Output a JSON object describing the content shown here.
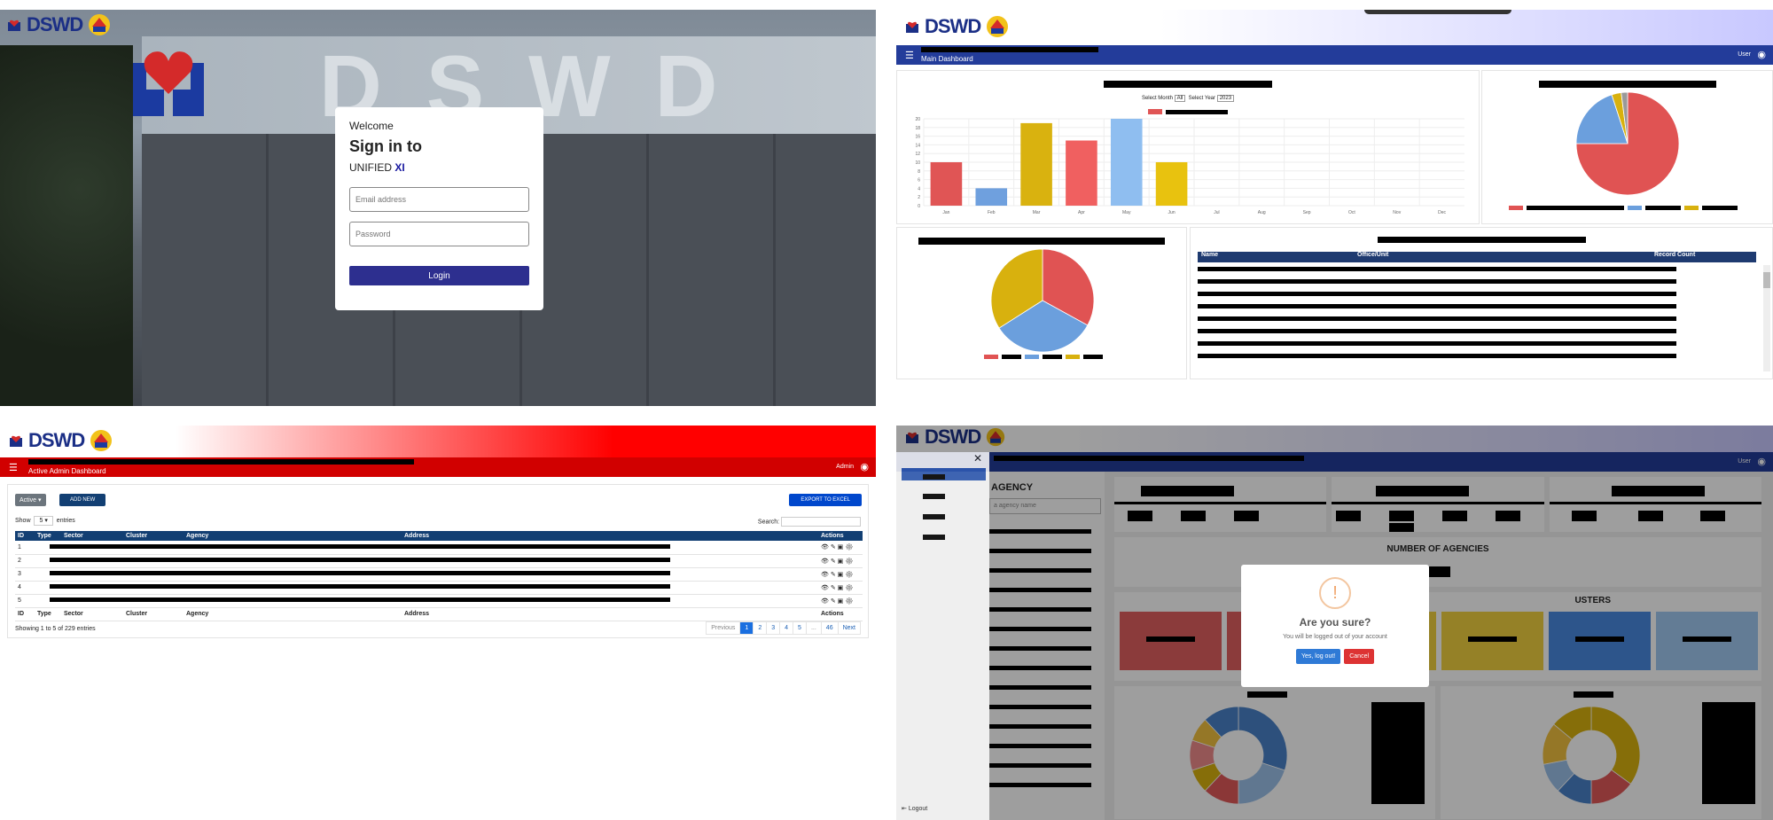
{
  "login": {
    "brand": "DSWD",
    "sign_text": "DSWD",
    "welcome": "Welcome",
    "sign_in": "Sign in to",
    "app_name_prefix": "UNIFIED ",
    "app_name_suffix": "XI",
    "email_placeholder": "Email address",
    "password_placeholder": "Password",
    "login_label": "Login"
  },
  "dashboard": {
    "brand": "DSWD",
    "subtitle": "Main Dashboard",
    "user_label": "User",
    "month_label": "Select Month",
    "month_value": "All",
    "year_label": "Select Year",
    "year_value": "2023",
    "months": [
      "Jan",
      "Feb",
      "Mar",
      "Apr",
      "May",
      "Jun",
      "Jul",
      "Aug",
      "Sep",
      "Oct",
      "Nov",
      "Dec"
    ],
    "bar_values": [
      10,
      4,
      19,
      15,
      20,
      10,
      0,
      0,
      0,
      0,
      0,
      0
    ],
    "bar_colors": [
      "#e05555",
      "#6fa0de",
      "#d9b20f",
      "#f06060",
      "#8fbef0",
      "#e8c20f",
      "#ccc",
      "#ccc",
      "#ccc",
      "#ccc",
      "#ccc",
      "#ccc"
    ],
    "yticks": [
      "0",
      "2",
      "4",
      "6",
      "8",
      "10",
      "12",
      "14",
      "16",
      "18",
      "20"
    ],
    "pie1_values": [
      75,
      20,
      3,
      2
    ],
    "pie1_colors": [
      "#e05353",
      "#6b9fdd",
      "#d8b10e",
      "#9a9a9a"
    ],
    "pie2_values": [
      33,
      33,
      34
    ],
    "pie2_colors": [
      "#e05353",
      "#6b9fdd",
      "#d8b10e"
    ],
    "table_headers": [
      "Name",
      "Office/Unit",
      "Record Count"
    ]
  },
  "admin": {
    "brand": "DSWD",
    "subtitle": "Active Admin Dashboard",
    "user_label": "Admin",
    "filter_label": "Active",
    "add_new": "ADD NEW",
    "export": "EXPORT TO EXCEL",
    "show_label": "Show",
    "show_value": "5",
    "entries_label": "entries",
    "search_label": "Search:",
    "headers": [
      "ID",
      "Type",
      "Sector",
      "Cluster",
      "Agency",
      "Address",
      "Actions"
    ],
    "row_ids": [
      "1",
      "2",
      "3",
      "4",
      "5"
    ],
    "info": "Showing 1 to 5 of 229 entries",
    "pages": [
      "Previous",
      "1",
      "2",
      "3",
      "4",
      "5",
      "...",
      "46",
      "Next"
    ]
  },
  "logout": {
    "brand": "DSWD",
    "user_label": "User",
    "agency_heading": "AGENCY",
    "search_placeholder": "a agency name",
    "number_of_agencies": "NUMBER OF AGENCIES",
    "clusters_heading": "USTERS",
    "logout_label": "Logout",
    "modal_icon": "!",
    "modal_title": "Are you sure?",
    "modal_message": "You will be logged out of your account",
    "confirm_label": "Yes, log out!",
    "cancel_label": "Cancel",
    "cluster_colors": [
      "#e06060",
      "#e06060",
      "#f0d040",
      "#f0d040",
      "#4a8ae0",
      "#a0c8f0"
    ],
    "donut1_colors": [
      "#4a82c8",
      "#9cc0e8",
      "#e05a5a",
      "#d9b20f",
      "#ef8c8c",
      "#f0c040"
    ],
    "donut2_colors": [
      "#d9b20f",
      "#e05a5a",
      "#4a82c8",
      "#9cc0e8",
      "#f0c040"
    ]
  }
}
